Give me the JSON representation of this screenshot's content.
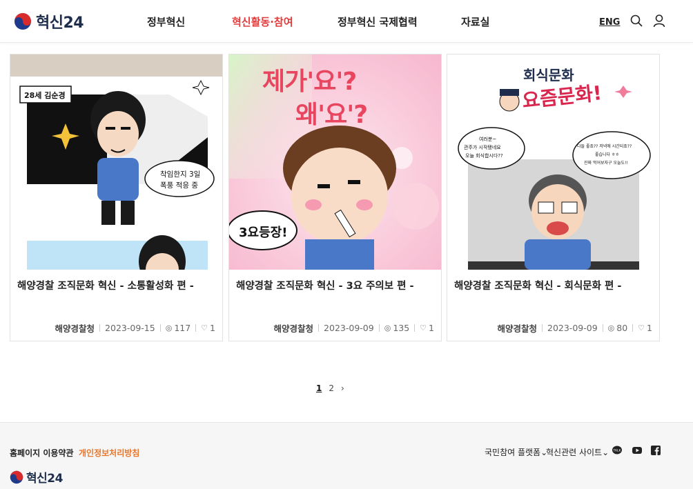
{
  "header": {
    "logo_text": "혁신24",
    "nav": [
      {
        "label": "정부혁신",
        "active": false
      },
      {
        "label": "혁신활동·참여",
        "active": true
      },
      {
        "label": "정부혁신 국제협력",
        "active": false
      },
      {
        "label": "자료실",
        "active": false
      }
    ],
    "lang_label": "ENG",
    "icons": [
      "search-icon",
      "user-icon"
    ]
  },
  "cards": [
    {
      "title": "해양경찰 조직문화 혁신 - 소통활성화 편 -",
      "agency": "해양경찰청",
      "date": "2023-09-15",
      "views": "117",
      "likes": "1",
      "thumb_texts": {
        "name_tag": "28세 김순경",
        "bubble_line1": "착임한지 3일",
        "bubble_line2": "폭풍 적응 중"
      }
    },
    {
      "title": "해양경찰 조직문화 혁신 - 3요 주의보 편 -",
      "agency": "해양경찰청",
      "date": "2023-09-09",
      "views": "135",
      "likes": "1",
      "thumb_texts": {
        "headline1": "제가'요'?",
        "headline2": "왜'요'?",
        "badge": "3요등장!"
      }
    },
    {
      "title": "해양경찰 조직문화 혁신 - 회식문화 편 -",
      "agency": "해양경찰청",
      "date": "2023-09-09",
      "views": "80",
      "likes": "1",
      "thumb_texts": {
        "headline1": "회식문화",
        "headline2": "요즘문화!",
        "bubble_left1": "여러분~",
        "bubble_left2": "관주가 시작됐네요",
        "bubble_left3": "오늘 회식합시다??",
        "bubble_right1": "다들 좋죠?? 저녁에 시간되죠??",
        "bubble_right2": "좋습니다 ㅎㅎ",
        "bubble_right3": "진짜 먹어보자구 오늘도!!"
      }
    }
  ],
  "pagination": {
    "pages": [
      "1",
      "2"
    ],
    "current": "1",
    "next": "›"
  },
  "footer": {
    "terms": "홈페이지 이용약관",
    "privacy": "개인정보처리방침",
    "logo_text": "혁신24",
    "platform": "국민참여 플랫폼⌄",
    "related": "혁신관련 사이트⌄",
    "sns": [
      "kakao-talk-icon",
      "youtube-icon",
      "facebook-icon"
    ]
  },
  "colors": {
    "accent": "#e23b3b",
    "privacy": "#e8772e",
    "logo_blue": "#1f2d4d"
  }
}
